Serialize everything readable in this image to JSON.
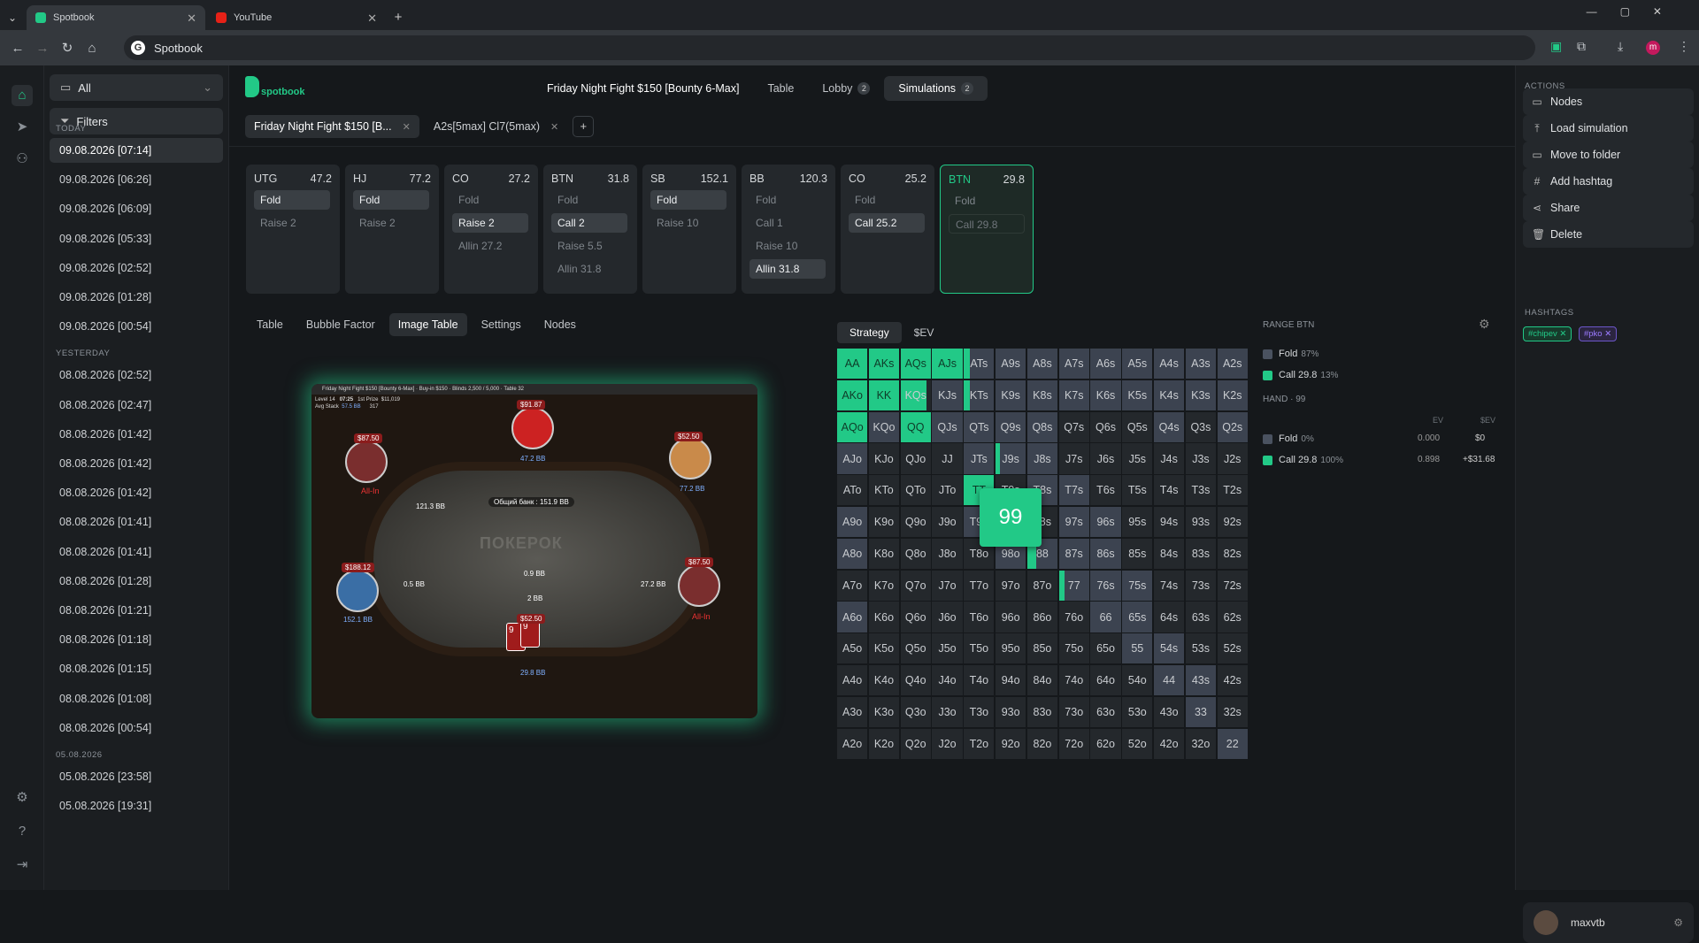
{
  "browser": {
    "tabs": [
      {
        "label": "Spotbook",
        "active": true
      },
      {
        "label": "YouTube",
        "active": false
      }
    ],
    "url": "Spotbook",
    "profile_initial": "m"
  },
  "sidebar": {
    "filter_select": "All",
    "filters_label": "Filters",
    "groups": [
      {
        "title": "TODAY",
        "items": [
          "09.08.2026 [07:14]",
          "09.08.2026 [06:26]",
          "09.08.2026 [06:09]",
          "09.08.2026 [05:33]",
          "09.08.2026 [02:52]",
          "09.08.2026 [01:28]",
          "09.08.2026 [00:54]"
        ]
      },
      {
        "title": "YESTERDAY",
        "items": [
          "08.08.2026 [02:52]",
          "08.08.2026 [02:47]",
          "08.08.2026 [01:42]",
          "08.08.2026 [01:42]",
          "08.08.2026 [01:42]",
          "08.08.2026 [01:41]",
          "08.08.2026 [01:41]",
          "08.08.2026 [01:28]",
          "08.08.2026 [01:21]",
          "08.08.2026 [01:18]",
          "08.08.2026 [01:15]",
          "08.08.2026 [01:08]",
          "08.08.2026 [00:54]"
        ]
      },
      {
        "title": "05.08.2026",
        "items": [
          "05.08.2026 [23:58]",
          "05.08.2026 [19:31]"
        ]
      }
    ]
  },
  "header": {
    "logo_text": "spotbook",
    "title": "Friday Night Fight $150 [Bounty 6-Max]",
    "nav": [
      {
        "label": "Table",
        "badge": ""
      },
      {
        "label": "Lobby",
        "badge": "2"
      },
      {
        "label": "Simulations",
        "badge": "2"
      }
    ],
    "file_tabs": [
      "Friday Night Fight $150 [B...",
      "A2s[5max] Cl7(5max)"
    ]
  },
  "positions": [
    {
      "name": "UTG",
      "stack": "47.2",
      "actions": [
        {
          "label": "Fold",
          "on": true
        },
        {
          "label": "Raise 2",
          "on": false
        }
      ]
    },
    {
      "name": "HJ",
      "stack": "77.2",
      "actions": [
        {
          "label": "Fold",
          "on": true
        },
        {
          "label": "Raise 2",
          "on": false
        }
      ]
    },
    {
      "name": "CO",
      "stack": "27.2",
      "actions": [
        {
          "label": "Fold",
          "on": false
        },
        {
          "label": "Raise 2",
          "on": true
        },
        {
          "label": "Allin 27.2",
          "on": false
        }
      ]
    },
    {
      "name": "BTN",
      "stack": "31.8",
      "actions": [
        {
          "label": "Fold",
          "on": false
        },
        {
          "label": "Call 2",
          "on": true
        },
        {
          "label": "Raise 5.5",
          "on": false
        },
        {
          "label": "Allin 31.8",
          "on": false
        }
      ]
    },
    {
      "name": "SB",
      "stack": "152.1",
      "actions": [
        {
          "label": "Fold",
          "on": true
        },
        {
          "label": "Raise 10",
          "on": false
        }
      ]
    },
    {
      "name": "BB",
      "stack": "120.3",
      "actions": [
        {
          "label": "Fold",
          "on": false
        },
        {
          "label": "Call 1",
          "on": false
        },
        {
          "label": "Raise 10",
          "on": false
        },
        {
          "label": "Allin 31.8",
          "on": true
        }
      ]
    },
    {
      "name": "CO",
      "stack": "25.2",
      "actions": [
        {
          "label": "Fold",
          "on": false
        },
        {
          "label": "Call 25.2",
          "on": true
        }
      ]
    },
    {
      "name": "BTN",
      "stack": "29.8",
      "actions": [
        {
          "label": "Fold",
          "on": false
        },
        {
          "label": "Call 29.8",
          "on": false
        }
      ]
    }
  ],
  "subtabs": [
    "Table",
    "Bubble Factor",
    "Image Table",
    "Settings",
    "Nodes"
  ],
  "table_image": {
    "title": "Friday Night Fight $150 [Bounty 6-Max] · Buy-in $150 · Blinds 2,500 / 5,000 · Table 32",
    "level": "Level 14",
    "time": "07:25",
    "first_prize_label": "1st Prize",
    "first_prize": "$11,019",
    "avg_stack_label": "Avg Stack",
    "avg_stack": "57.5 BB",
    "players": "317",
    "pot": "Общий банк : 151.9 BB",
    "watermark": "ПОКЕРОК",
    "seats": [
      {
        "bounty": "$91.87",
        "stack": "47.2 BB"
      },
      {
        "bounty": "$52.50",
        "stack": "77.2 BB"
      },
      {
        "bounty": "$87.50",
        "stack": "",
        "status": "All-In"
      },
      {
        "bounty": "$87.50",
        "stack": "",
        "status": "All-In"
      },
      {
        "bounty": "$188.12",
        "stack": "152.1 BB"
      },
      {
        "bounty": "$52.50",
        "stack": "29.8 BB"
      }
    ],
    "bets": [
      "121.3 BB",
      "0.5 BB",
      "0.9 BB",
      "2 BB",
      "27.2 BB"
    ],
    "hero_cards": [
      "9",
      "9"
    ]
  },
  "strategy": {
    "tabs": [
      "Strategy",
      "$EV"
    ],
    "hover_hand": "99",
    "grid": [
      [
        "AA",
        "AKs",
        "AQs",
        "AJs",
        "ATs",
        "A9s",
        "A8s",
        "A7s",
        "A6s",
        "A5s",
        "A4s",
        "A3s",
        "A2s"
      ],
      [
        "AKo",
        "KK",
        "KQs",
        "KJs",
        "KTs",
        "K9s",
        "K8s",
        "K7s",
        "K6s",
        "K5s",
        "K4s",
        "K3s",
        "K2s"
      ],
      [
        "AQo",
        "KQo",
        "QQ",
        "QJs",
        "QTs",
        "Q9s",
        "Q8s",
        "Q7s",
        "Q6s",
        "Q5s",
        "Q4s",
        "Q3s",
        "Q2s"
      ],
      [
        "AJo",
        "KJo",
        "QJo",
        "JJ",
        "JTs",
        "J9s",
        "J8s",
        "J7s",
        "J6s",
        "J5s",
        "J4s",
        "J3s",
        "J2s"
      ],
      [
        "ATo",
        "KTo",
        "QTo",
        "JTo",
        "TT",
        "T9s",
        "T8s",
        "T7s",
        "T6s",
        "T5s",
        "T4s",
        "T3s",
        "T2s"
      ],
      [
        "A9o",
        "K9o",
        "Q9o",
        "J9o",
        "T9o",
        "99",
        "98s",
        "97s",
        "96s",
        "95s",
        "94s",
        "93s",
        "92s"
      ],
      [
        "A8o",
        "K8o",
        "Q8o",
        "J8o",
        "T8o",
        "98o",
        "88",
        "87s",
        "86s",
        "85s",
        "84s",
        "83s",
        "82s"
      ],
      [
        "A7o",
        "K7o",
        "Q7o",
        "J7o",
        "T7o",
        "97o",
        "87o",
        "77",
        "76s",
        "75s",
        "74s",
        "73s",
        "72s"
      ],
      [
        "A6o",
        "K6o",
        "Q6o",
        "J6o",
        "T6o",
        "96o",
        "86o",
        "76o",
        "66",
        "65s",
        "64s",
        "63s",
        "62s"
      ],
      [
        "A5o",
        "K5o",
        "Q5o",
        "J5o",
        "T5o",
        "95o",
        "85o",
        "75o",
        "65o",
        "55",
        "54s",
        "53s",
        "52s"
      ],
      [
        "A4o",
        "K4o",
        "Q4o",
        "J4o",
        "T4o",
        "94o",
        "84o",
        "74o",
        "64o",
        "54o",
        "44",
        "43s",
        "42s"
      ],
      [
        "A3o",
        "K3o",
        "Q3o",
        "J3o",
        "T3o",
        "93o",
        "83o",
        "73o",
        "63o",
        "53o",
        "43o",
        "33",
        "32s"
      ],
      [
        "A2o",
        "K2o",
        "Q2o",
        "J2o",
        "T2o",
        "92o",
        "82o",
        "72o",
        "62o",
        "52o",
        "42o",
        "32o",
        "22"
      ]
    ],
    "call_freq": [
      [
        1,
        1,
        1,
        1,
        0.2,
        0,
        0,
        0,
        0,
        0,
        0,
        0,
        0
      ],
      [
        1,
        1,
        0.85,
        0,
        0.2,
        0,
        0,
        0,
        0,
        0,
        0,
        0,
        0
      ],
      [
        1,
        0,
        1,
        0,
        0,
        0,
        0,
        0,
        0,
        0,
        0,
        0,
        0
      ],
      [
        0,
        0,
        0,
        0,
        0,
        0.15,
        0,
        0,
        0,
        0,
        0,
        0,
        0
      ],
      [
        0,
        0,
        0,
        0,
        1,
        0,
        0,
        0,
        0,
        0,
        0,
        0,
        0
      ],
      [
        0,
        0,
        0,
        0,
        0,
        1,
        0,
        0,
        0,
        0,
        0,
        0,
        0
      ],
      [
        0,
        0,
        0,
        0,
        0,
        0,
        0.3,
        0,
        0,
        0,
        0,
        0,
        0
      ],
      [
        0,
        0,
        0,
        0,
        0,
        0,
        0,
        0.2,
        0,
        0,
        0,
        0,
        0
      ],
      [
        0,
        0,
        0,
        0,
        0,
        0,
        0,
        0,
        0,
        0,
        0,
        0,
        0
      ],
      [
        0,
        0,
        0,
        0,
        0,
        0,
        0,
        0,
        0,
        0,
        0,
        0,
        0
      ],
      [
        0,
        0,
        0,
        0,
        0,
        0,
        0,
        0,
        0,
        0,
        0,
        0,
        0
      ],
      [
        0,
        0,
        0,
        0,
        0,
        0,
        0,
        0,
        0,
        0,
        0,
        0,
        0
      ],
      [
        0,
        0,
        0,
        0,
        0,
        0,
        0,
        0,
        0,
        0,
        0,
        0,
        0
      ]
    ],
    "fold_cells": [
      "AJo",
      "KQo",
      "KJs",
      "KTs",
      "K9s",
      "K8s",
      "K7s",
      "K6s",
      "K5s",
      "K4s",
      "K3s",
      "K2s",
      "ATs",
      "A9s",
      "A8s",
      "A7s",
      "A6s",
      "A5s",
      "A4s",
      "A3s",
      "A2s",
      "QJs",
      "QTs",
      "Q9s",
      "Q8s",
      "Q4s",
      "Q2s",
      "JTs",
      "J9s",
      "J8s",
      "T8s",
      "T7s",
      "T9o",
      "A9o",
      "A8o",
      "98o",
      "88",
      "97s",
      "96s",
      "87s",
      "86s",
      "77",
      "76s",
      "75s",
      "A6o",
      "66",
      "65s",
      "55",
      "54s",
      "44",
      "43s",
      "33",
      "22"
    ]
  },
  "range_panel": {
    "title": "RANGE BTN",
    "range": [
      {
        "label": "Fold",
        "pct": "87%",
        "color": "#4a5260"
      },
      {
        "label": "Call 29.8",
        "pct": "13%",
        "color": "#22c987"
      }
    ],
    "hand_title": "HAND · 99",
    "col_ev": "EV",
    "col_sev": "$EV",
    "hand": [
      {
        "label": "Fold",
        "pct": "0%",
        "ev": "0.000",
        "sev": "$0",
        "color": "#4a5260"
      },
      {
        "label": "Call 29.8",
        "pct": "100%",
        "ev": "0.898",
        "sev": "+$31.68",
        "color": "#22c987"
      }
    ]
  },
  "actions_panel": {
    "title": "ACTIONS",
    "buttons": [
      {
        "label": "Nodes",
        "icon": "message-icon"
      },
      {
        "label": "Load simulation",
        "icon": "upload-icon"
      },
      {
        "label": "Move to folder",
        "icon": "folder-icon"
      },
      {
        "label": "Add hashtag",
        "icon": "hash-icon"
      },
      {
        "label": "Share",
        "icon": "share-icon"
      },
      {
        "label": "Delete",
        "icon": "trash-icon"
      }
    ],
    "hashtags_title": "HASHTAGS",
    "hashtags": [
      "#chipev",
      "#pko"
    ],
    "username": "maxvtb"
  },
  "colors": {
    "accent": "#22c987",
    "fold": "#3c4350",
    "panel": "#24282c"
  }
}
